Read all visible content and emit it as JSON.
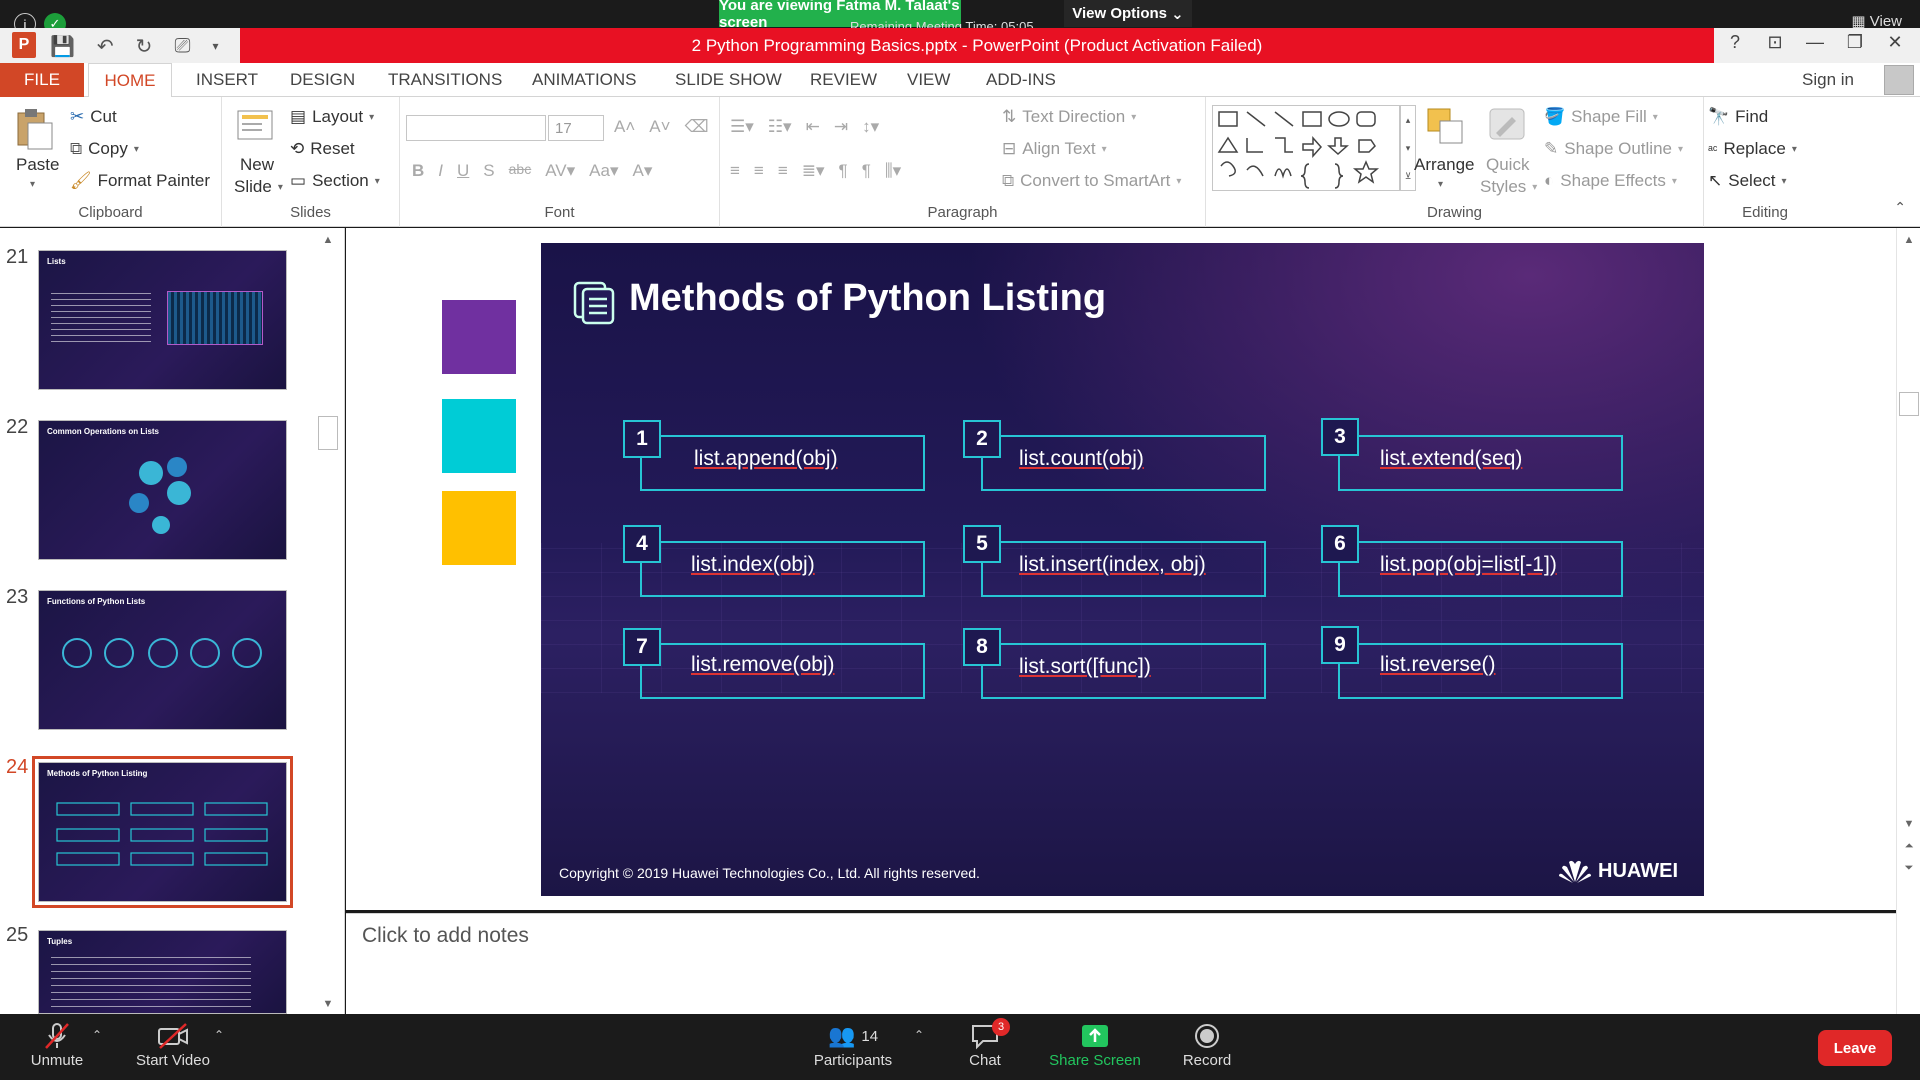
{
  "zoom": {
    "viewing_banner": "You are viewing Fatma M. Talaat's screen",
    "view_options": "View Options",
    "remaining_time": "Remaining Meeting Time: 05:05",
    "view_label": "View",
    "controls": {
      "unmute": "Unmute",
      "start_video": "Start Video",
      "participants": "Participants",
      "participants_count": "14",
      "chat": "Chat",
      "chat_badge": "3",
      "share_screen": "Share Screen",
      "record": "Record",
      "leave": "Leave"
    }
  },
  "window": {
    "title": "2 Python Programming Basics.pptx -  PowerPoint (Product Activation Failed)",
    "sign_in": "Sign in",
    "help": "?"
  },
  "tabs": [
    "FILE",
    "HOME",
    "INSERT",
    "DESIGN",
    "TRANSITIONS",
    "ANIMATIONS",
    "SLIDE SHOW",
    "REVIEW",
    "VIEW",
    "ADD-INS"
  ],
  "ribbon": {
    "clipboard": {
      "label": "Clipboard",
      "paste": "Paste",
      "cut": "Cut",
      "copy": "Copy",
      "format_painter": "Format Painter"
    },
    "slides": {
      "label": "Slides",
      "new_slide_line1": "New",
      "new_slide_line2": "Slide",
      "layout": "Layout",
      "reset": "Reset",
      "section": "Section"
    },
    "font": {
      "label": "Font",
      "font_name": "",
      "font_size": "17"
    },
    "paragraph": {
      "label": "Paragraph",
      "text_direction": "Text Direction",
      "align_text": "Align Text",
      "convert_smartart": "Convert to SmartArt"
    },
    "drawing": {
      "label": "Drawing",
      "arrange": "Arrange",
      "quick_styles_line1": "Quick",
      "quick_styles_line2": "Styles",
      "shape_fill": "Shape Fill",
      "shape_outline": "Shape Outline",
      "shape_effects": "Shape Effects"
    },
    "editing": {
      "label": "Editing",
      "find": "Find",
      "replace": "Replace",
      "select": "Select"
    }
  },
  "thumbnails": [
    {
      "num": "21",
      "title": "Lists"
    },
    {
      "num": "22",
      "title": "Common Operations on Lists"
    },
    {
      "num": "23",
      "title": "Functions of Python Lists"
    },
    {
      "num": "24",
      "title": "Methods of Python Listing"
    },
    {
      "num": "25",
      "title": "Tuples"
    }
  ],
  "slide": {
    "title": "Methods of Python Listing",
    "methods": [
      {
        "num": "1",
        "text": "list.append(obj)"
      },
      {
        "num": "2",
        "text": "list.count(obj)"
      },
      {
        "num": "3",
        "text": "list.extend(seq)"
      },
      {
        "num": "4",
        "text": "list.index(obj)"
      },
      {
        "num": "5",
        "text": "list.insert(index, obj)"
      },
      {
        "num": "6",
        "text": "list.pop(obj=list[-1])"
      },
      {
        "num": "7",
        "text": "list.remove(obj)"
      },
      {
        "num": "8",
        "text": "list.sort([func])"
      },
      {
        "num": "9",
        "text": "list.reverse()"
      }
    ],
    "copyright": "Copyright © 2019 Huawei Technologies Co., Ltd. All rights reserved.",
    "logo_text": "HUAWEI"
  },
  "swatches": [
    "#7030a0",
    "#00ccd6",
    "#ffc000"
  ],
  "notes_placeholder": "Click to add notes",
  "colors": {
    "accent": "#d24726",
    "title_bar": "#e81123",
    "zoom_green": "#22b14c",
    "slide_box": "#27c5d4"
  }
}
